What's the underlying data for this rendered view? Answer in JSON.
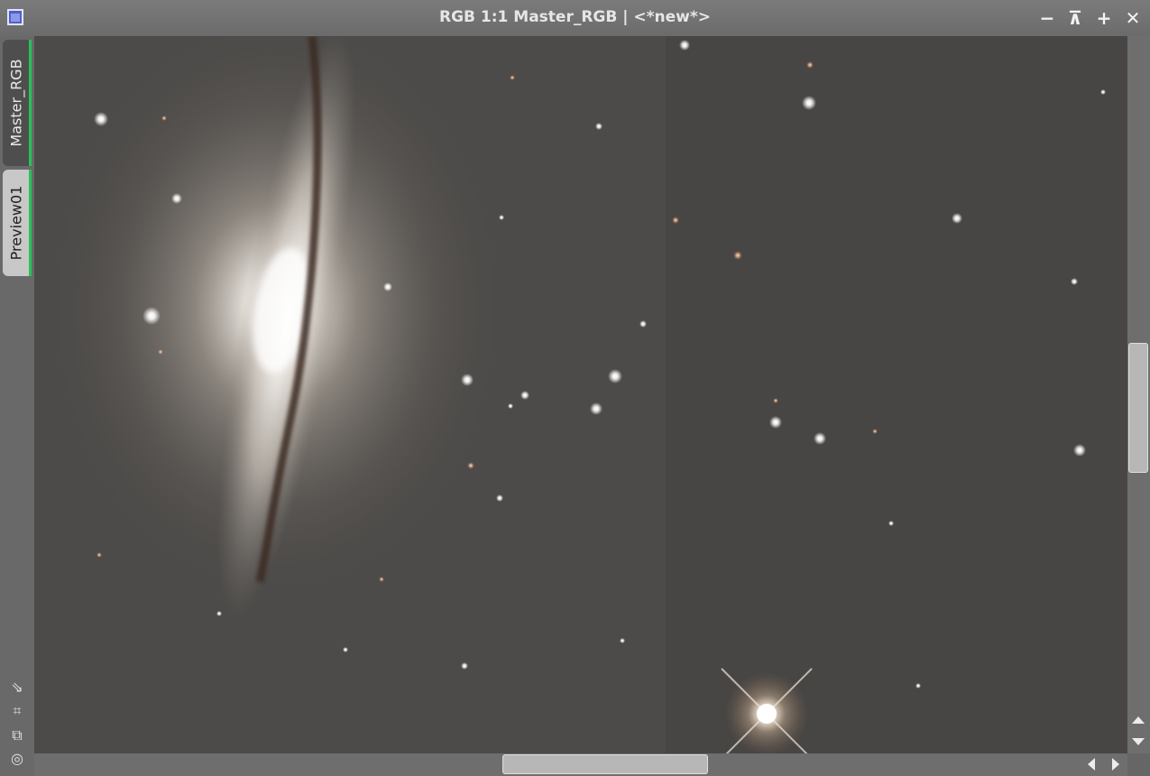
{
  "window": {
    "title": "RGB 1:1 Master_RGB | <*new*>",
    "controls": {
      "minimize": "−",
      "shade": "⊼",
      "maximize": "+",
      "close": "✕"
    }
  },
  "tabs": [
    {
      "label": "Master_RGB",
      "active": true
    },
    {
      "label": "Preview01",
      "active": false
    }
  ],
  "tab_accent_color": "#26c35a",
  "side_tools": [
    {
      "name": "fit-arrow-icon",
      "glyph": "⇘"
    },
    {
      "name": "crop-icon",
      "glyph": "⌗"
    },
    {
      "name": "clone-icon",
      "glyph": "⧉"
    },
    {
      "name": "target-icon",
      "glyph": "◎"
    }
  ],
  "image": {
    "subject": "edge-on spiral galaxy with dark dust lane and star field",
    "background_color": "#484644"
  },
  "scrollbars": {
    "vertical": {
      "position": 0.5,
      "visible_fraction": 0.18
    },
    "horizontal": {
      "position": 0.5,
      "visible_fraction": 0.19
    }
  }
}
